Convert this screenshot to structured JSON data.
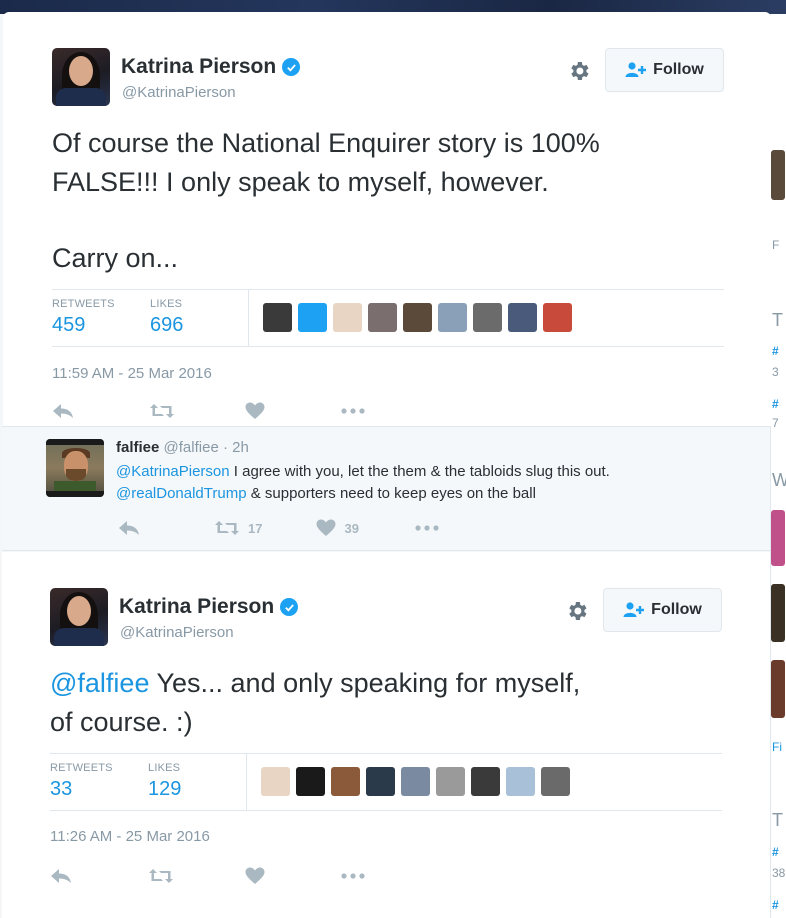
{
  "tweet1": {
    "author": "Katrina Pierson",
    "handle": "@KatrinaPierson",
    "follow_label": "Follow",
    "text_lines": [
      "Of course the National Enquirer story is 100%",
      "FALSE!!!  I only speak to myself, however.",
      "",
      "Carry on..."
    ],
    "retweets_label": "RETWEETS",
    "retweets": "459",
    "likes_label": "LIKES",
    "likes": "696",
    "timestamp": "11:59 AM - 25 Mar 2016",
    "likers": [
      "#3a3a3a",
      "#1da1f2",
      "#e8d5c4",
      "#7a6e6e",
      "#5b4a3a",
      "#8aa0b8",
      "#6b6b6b",
      "#4a5a7a",
      "#c84a3a"
    ]
  },
  "reply": {
    "author": "falfiee",
    "handle": "@falfiee",
    "separator": "·",
    "time": "2h",
    "mention1": "@KatrinaPierson",
    "text1": " I agree with you, let the them & the tabloids slug this out.",
    "mention2": "@realDonaldTrump",
    "text2": " & supporters need to keep eyes on the ball",
    "retweet_count": "17",
    "like_count": "39"
  },
  "tweet2": {
    "author": "Katrina Pierson",
    "handle": "@KatrinaPierson",
    "follow_label": "Follow",
    "mention": "@falfiee",
    "text_line1": " Yes... and only speaking for myself,",
    "text_line2": "of course. :)",
    "retweets_label": "RETWEETS",
    "retweets": "33",
    "likes_label": "LIKES",
    "likes": "129",
    "timestamp": "11:26 AM - 25 Mar 2016",
    "likers": [
      "#e8d5c4",
      "#1a1a1a",
      "#8a5a3a",
      "#2a3a4a",
      "#7a8aa0",
      "#9a9a9a",
      "#3a3a3a",
      "#a8c0d8",
      "#6a6a6a"
    ]
  },
  "sidebar_edge": {
    "items": [
      "F",
      "T",
      "#",
      "3",
      "#",
      "7",
      "W",
      "Fi",
      "T",
      "#",
      "38",
      "#"
    ]
  }
}
